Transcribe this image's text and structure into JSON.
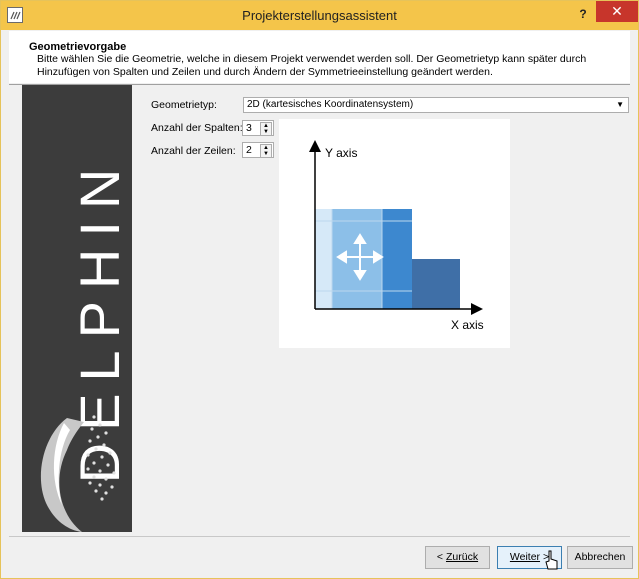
{
  "window": {
    "title": "Projekterstellungsassistent",
    "help_label": "?",
    "close_label": "✕"
  },
  "header": {
    "title": "Geometrievorgabe",
    "description": "Bitte wählen Sie die Geometrie, welche in diesem Projekt verwendet werden soll. Der Geometrietyp kann später durch Hinzufügen von Spalten und Zeilen und durch Ändern der Symmetrieeinstellung geändert werden."
  },
  "banner": {
    "brand": "DELPHIN"
  },
  "form": {
    "geometry_label": "Geometrietyp:",
    "geometry_value": "2D (kartesisches Koordinatensystem)",
    "columns_label": "Anzahl der Spalten:",
    "columns_value": "3",
    "rows_label": "Anzahl der Zeilen:",
    "rows_value": "2"
  },
  "preview": {
    "y_axis_label": "Y axis",
    "x_axis_label": "X axis"
  },
  "buttons": {
    "back_prefix": "< ",
    "back_label": "Zurück",
    "next_label": "Weiter",
    "next_suffix": " >",
    "cancel_label": "Abbrechen"
  },
  "colors": {
    "titlebar": "#f4c54a",
    "close": "#c7352b",
    "banner": "#3c3c3c"
  }
}
